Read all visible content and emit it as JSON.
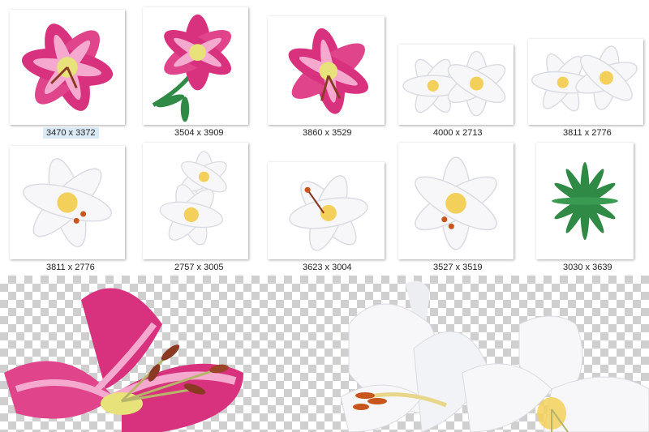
{
  "gallery": {
    "items": [
      {
        "dimensions": "3470 x 3372",
        "subject": "pink-lily",
        "selected": true
      },
      {
        "dimensions": "3504 x 3909",
        "subject": "pink-lily-with-leaves",
        "selected": false
      },
      {
        "dimensions": "3860 x 3529",
        "subject": "pink-lily",
        "selected": false
      },
      {
        "dimensions": "4000 x 2713",
        "subject": "white-lily-pair",
        "selected": false
      },
      {
        "dimensions": "3811 x 2776",
        "subject": "white-lily-pair",
        "selected": false
      },
      {
        "dimensions": "3811 x 2776",
        "subject": "white-lily",
        "selected": false
      },
      {
        "dimensions": "2757 x 3005",
        "subject": "white-lily-pair",
        "selected": false
      },
      {
        "dimensions": "3623 x 3004",
        "subject": "white-lily",
        "selected": false
      },
      {
        "dimensions": "3527 x 3519",
        "subject": "white-lily",
        "selected": false
      },
      {
        "dimensions": "3030 x 3639",
        "subject": "green-leaves",
        "selected": false
      }
    ]
  },
  "colors": {
    "pink_petal": "#d8327e",
    "pink_light": "#f5a9cf",
    "white_petal": "#f7f7f9",
    "petal_shadow": "#d9dbe2",
    "lily_throat": "#f3d05a",
    "anther": "#c8561c",
    "leaf_green": "#2f8a45",
    "checker_gray": "#cfcfcf",
    "selection": "#dbeaf7"
  },
  "preview": {
    "background": "transparency-checkerboard",
    "subjects": [
      "pink-lily-closeup",
      "white-lily-closeup"
    ]
  }
}
